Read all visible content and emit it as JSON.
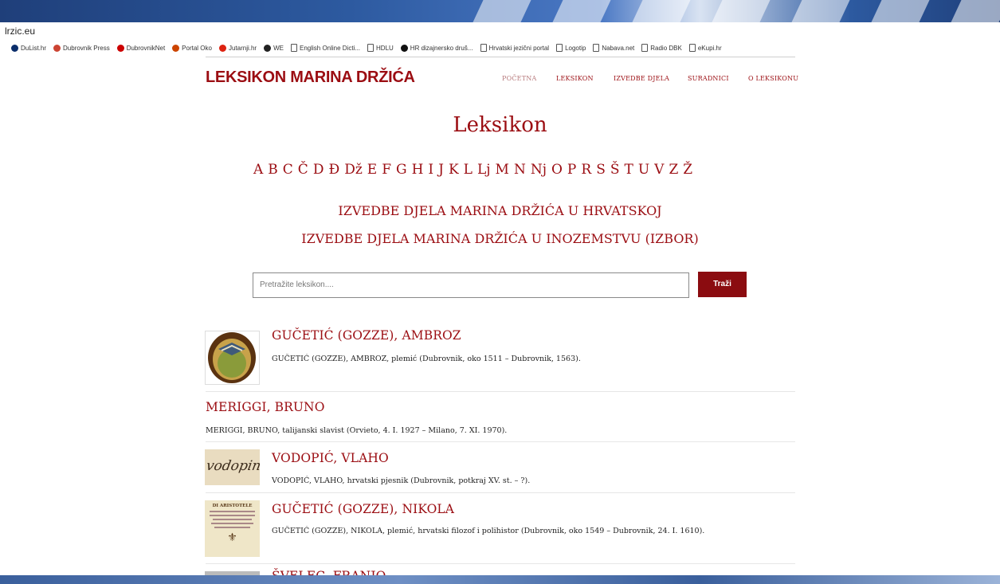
{
  "browser": {
    "url": "lrzic.eu",
    "bookmarks": [
      {
        "label": "DuList.hr",
        "icon": "dl-icon",
        "color": "#0b2e6b"
      },
      {
        "label": "Dubrovnik Press",
        "icon": "dp-icon",
        "color": "#c43"
      },
      {
        "label": "DubrovnikNet",
        "icon": "dubrovniknet-icon",
        "color": "#c00"
      },
      {
        "label": "Portal Oko",
        "icon": "oko-icon",
        "color": "#c40"
      },
      {
        "label": "Jutarnji.hr",
        "icon": "jutarnji-icon",
        "color": "#d21"
      },
      {
        "label": "WE",
        "icon": "we-icon",
        "color": "#222"
      },
      {
        "label": "English Online Dicti...",
        "icon": "page-icon",
        "color": "#555"
      },
      {
        "label": "HDLU",
        "icon": "page-icon",
        "color": "#555"
      },
      {
        "label": "HR dizajnersko druš...",
        "icon": "d-icon",
        "color": "#111"
      },
      {
        "label": "Hrvatski jezični portal",
        "icon": "page-icon",
        "color": "#555"
      },
      {
        "label": "Logotip",
        "icon": "page-icon",
        "color": "#555"
      },
      {
        "label": "Nabava.net",
        "icon": "page-icon",
        "color": "#555"
      },
      {
        "label": "Radio DBK",
        "icon": "page-icon",
        "color": "#555"
      },
      {
        "label": "eKupi.hr",
        "icon": "page-icon",
        "color": "#555"
      }
    ]
  },
  "site": {
    "logo": "LEKSIKON MARINA DRŽIĆA",
    "nav": [
      "POČETNA",
      "LEKSIKON",
      "IZVEDBE DJELA",
      "SURADNICI",
      "O LEKSIKONU"
    ],
    "accent": "#9b0d12"
  },
  "page": {
    "title": "Leksikon",
    "letters": [
      "A",
      "B",
      "C",
      "Č",
      "D",
      "Đ",
      "Dž",
      "E",
      "F",
      "G",
      "H",
      "I",
      "J",
      "K",
      "L",
      "Lj",
      "M",
      "N",
      "Nj",
      "O",
      "P",
      "R",
      "S",
      "Š",
      "T",
      "U",
      "V",
      "Z",
      "Ž"
    ],
    "link_hr": "IZVEDBE DJELA MARINA DRŽIĆA U HRVATSKOJ",
    "link_int": "IZVEDBE DJELA MARINA DRŽIĆA U INOZEMSTVU (IZBOR)"
  },
  "search": {
    "placeholder": "Pretražite leksikon....",
    "button": "Traži"
  },
  "entries": [
    {
      "title": "GUČETIĆ (GOZZE), AMBROZ",
      "desc": "GUČETIĆ (GOZZE), AMBROZ, plemić (Dubrovnik, oko 1511 – Dubrovnik, 1563).",
      "thumb": "coat-of-arms"
    },
    {
      "title": "MERIGGI, BRUNO",
      "desc": "MERIGGI, BRUNO, talijanski slavist (Orvieto, 4. I. 1927 – Milano, 7. XI. 1970).",
      "thumb": ""
    },
    {
      "title": "VODOPIĆ, VLAHO",
      "desc": "VODOPIĆ, VLAHO, hrvatski pjesnik (Dubrovnik, potkraj XV. st. – ?).",
      "thumb": "handwriting",
      "thumb_text": "vodopin"
    },
    {
      "title": "GUČETIĆ (GOZZE), NIKOLA",
      "desc": "GUČETIĆ (GOZZE), NIKOLA, plemić, hrvatski filozof i polihistor (Dubrovnik, oko 1549 – Dubrovnik, 24. I. 1610).",
      "thumb": "title-page",
      "thumb_text": "DI ARISTOTELE"
    },
    {
      "title": "ŠVELEC, FRANJO",
      "desc": "",
      "thumb": "portrait"
    }
  ]
}
